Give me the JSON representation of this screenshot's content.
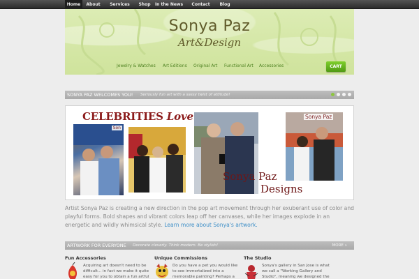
{
  "topnav": {
    "items": [
      {
        "label": "Home"
      },
      {
        "label": "About"
      },
      {
        "label": "Services"
      },
      {
        "label": "Shop"
      },
      {
        "label": "In the News"
      },
      {
        "label": "Contact"
      },
      {
        "label": "Blog"
      }
    ]
  },
  "header": {
    "logo_main": "Sonya Paz",
    "logo_sub": "Art&Design",
    "categories": [
      {
        "label": "Jewelry & Watches"
      },
      {
        "label": "Art Editions"
      },
      {
        "label": "Original Art"
      },
      {
        "label": "Functional Art"
      },
      {
        "label": "Accessories"
      }
    ],
    "cart_label": "CART"
  },
  "welcome_bar": {
    "title": "SONYA PAZ WELCOMES YOU!",
    "tagline": "Seriously fun art with a sassy twist of attitude!"
  },
  "slide": {
    "celebs_a": "CELEBRITIES",
    "celebs_b": "Love...",
    "badge": "Sonya Paz",
    "badge_small": "Son",
    "designs_l1": "Sonya Paz",
    "designs_l2": "Designs"
  },
  "intro": {
    "text": "Artist Sonya Paz is creating a new direction in the pop art movement through her exuberant use of color and playful forms. Bold shapes and vibrant colors leap off her canvases, while her images explode in an energetic and wildly whimsical style. ",
    "link": "Learn more about Sonya's artwork."
  },
  "artwork_bar": {
    "title": "ARTWORK FOR EVERYONE",
    "tagline": "Decorate cleverly. Think modern. Be stylish!",
    "more": "MORE »"
  },
  "columns": [
    {
      "title": "Fun Accessories",
      "text": "Acquiring art doesn't need to be difficult... in fact we make it quite easy for you to obtain a fun artful"
    },
    {
      "title": "Unique Commissions",
      "text": "Do you have a pet you would like to see immortalized into a memorable painting? Perhaps a custom"
    },
    {
      "title": "The Studio",
      "text": "Sonya's gallery in San Jose is what we call a \"Working Gallery and Studio\", meaning we designed the"
    }
  ],
  "colors": {
    "accent_green": "#8dc63f",
    "link_blue": "#3c8ec7",
    "header_green": "#d5e8a8",
    "logo_olive": "#5f5a2a"
  }
}
